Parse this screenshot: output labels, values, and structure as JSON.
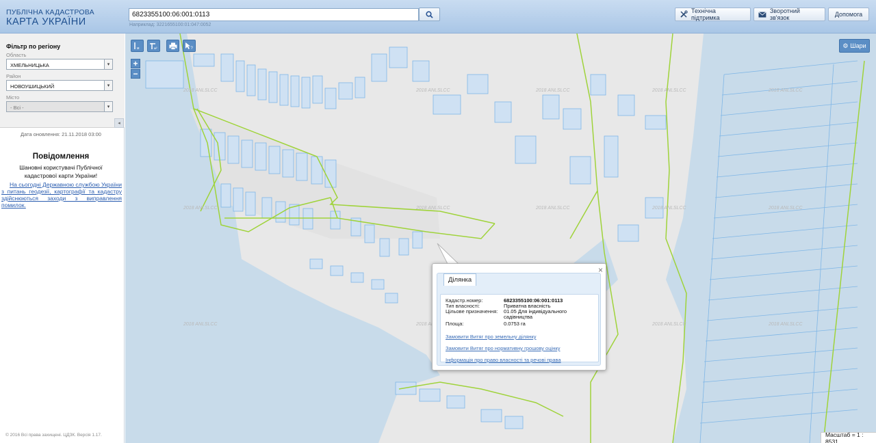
{
  "header": {
    "logo_line1": "ПУБЛІЧНА КАДАСТРОВА",
    "logo_line2": "КАРТА УКРАЇНИ",
    "search_value": "6823355100:06:001:0113",
    "search_hint": "Наприклад: 3221655100:01:047:0052",
    "buttons": {
      "support": "Технічна підтримка",
      "feedback": "Зворотний зв'язок",
      "help": "Допомога"
    }
  },
  "sidebar": {
    "filter_title": "Фільтр по регіону",
    "oblast_label": "Область",
    "oblast_value": "ХМЕЛЬНИЦЬКА",
    "rayon_label": "Район",
    "rayon_value": "НОВОУШИЦЬКИЙ",
    "misto_label": "Місто",
    "misto_value": "- Всі -",
    "update_date": "Дата оновлення: 21.11.2018 03:00",
    "notice_title": "Повідомлення",
    "notice_greeting": "Шановні користувачі Публічної кадастрової карти України!",
    "notice_link": "На сьогодні Державною службою України з питань геодезії, картографії та кадастру здійснюються заходи з виправлення помилок.",
    "copyright": "© 2016 Всі права захищені. ЦДЗК. Версія 1.17."
  },
  "map": {
    "layers_label": "Шари",
    "scale_text": "Масштаб = 1 : 8531",
    "watermark": "2018 ANLSLCC"
  },
  "popup": {
    "tab_label": "Ділянка",
    "rows": [
      {
        "label": "Кадастр.номер:",
        "value": "6823355100:06:001:0113"
      },
      {
        "label": "Тип власності:",
        "value": "Приватна власність"
      },
      {
        "label": "Цільове призначення:",
        "value": "01.05 Для індивідуального садівництва"
      },
      {
        "label": "Площа:",
        "value": "0.0753 га"
      }
    ],
    "links": [
      "Замовити Витяг про земельну ділянку",
      "Замовити Витяг про нормативну грошову оцінку",
      "Інформація про право власності та речові права"
    ]
  },
  "colors": {
    "header_bg": "#b9d1ec",
    "map_bg": "#e8e8e8",
    "water": "#c8dbea",
    "parcel_fill": "#cfe1f3",
    "parcel_stroke": "#7fb6e6",
    "boundary": "#9fd33a",
    "tool_button": "#5b8ec5"
  }
}
